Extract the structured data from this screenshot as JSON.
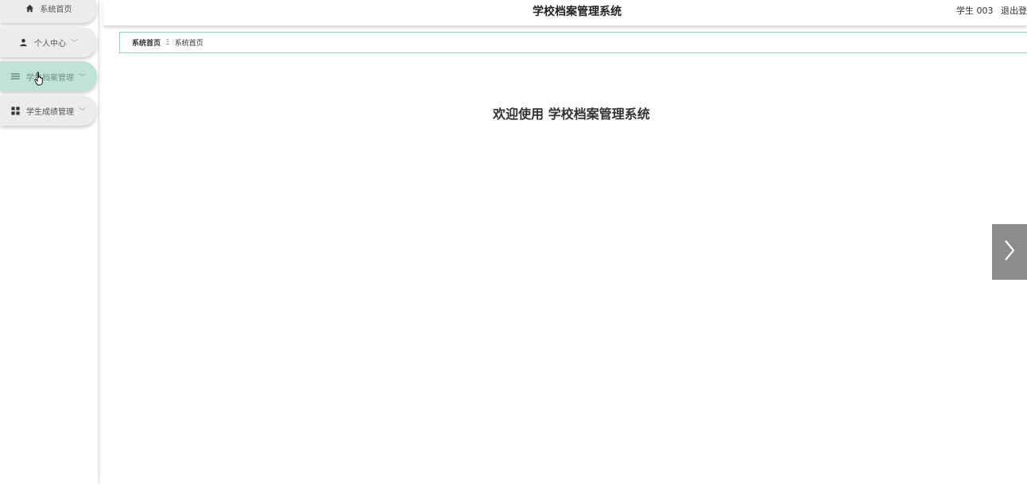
{
  "sidebar": {
    "items": [
      {
        "label": "系统首页",
        "icon": "home-icon"
      },
      {
        "label": "个人中心",
        "icon": "user-icon"
      },
      {
        "label": "学生档案管理",
        "icon": "list-icon"
      },
      {
        "label": "学生成绩管理",
        "icon": "grid-icon"
      }
    ]
  },
  "header": {
    "title": "学校档案管理系统",
    "user": "学生 003",
    "logout": "退出登录"
  },
  "breadcrumb": {
    "root": "系统首页",
    "separator": "Ξ",
    "current": "系统首页"
  },
  "main": {
    "welcome": "欢迎使用 学校档案管理系统"
  },
  "colors": {
    "accent": "#8fd6b6",
    "active_menu": "#bfe3d6",
    "arrow_button": "#8c8c8c"
  }
}
